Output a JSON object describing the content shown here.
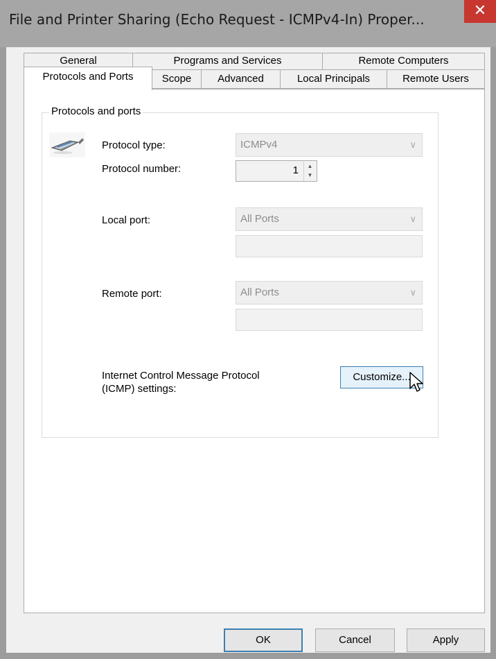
{
  "window": {
    "title": "File and Printer Sharing (Echo Request - ICMPv4-In) Proper...",
    "close_glyph": "✕"
  },
  "tabs": {
    "row1": [
      "General",
      "Programs and Services",
      "Remote Computers"
    ],
    "row2": [
      "Protocols and Ports",
      "Scope",
      "Advanced",
      "Local Principals",
      "Remote Users"
    ],
    "active": "Protocols and Ports"
  },
  "group": {
    "title": "Protocols and ports",
    "icon": "network-cable-icon",
    "protocol_type_label": "Protocol type:",
    "protocol_type_value": "ICMPv4",
    "protocol_number_label": "Protocol number:",
    "protocol_number_value": "1",
    "local_port_label": "Local port:",
    "local_port_value": "All Ports",
    "local_port_text": "",
    "remote_port_label": "Remote port:",
    "remote_port_value": "All Ports",
    "remote_port_text": "",
    "icmp_label_line1": "Internet Control Message Protocol",
    "icmp_label_line2": "(ICMP) settings:",
    "customize_label": "Customize..."
  },
  "buttons": {
    "ok": "OK",
    "cancel": "Cancel",
    "apply": "Apply"
  },
  "colors": {
    "close": "#c7372f",
    "focus_border": "#3c7fb1"
  }
}
